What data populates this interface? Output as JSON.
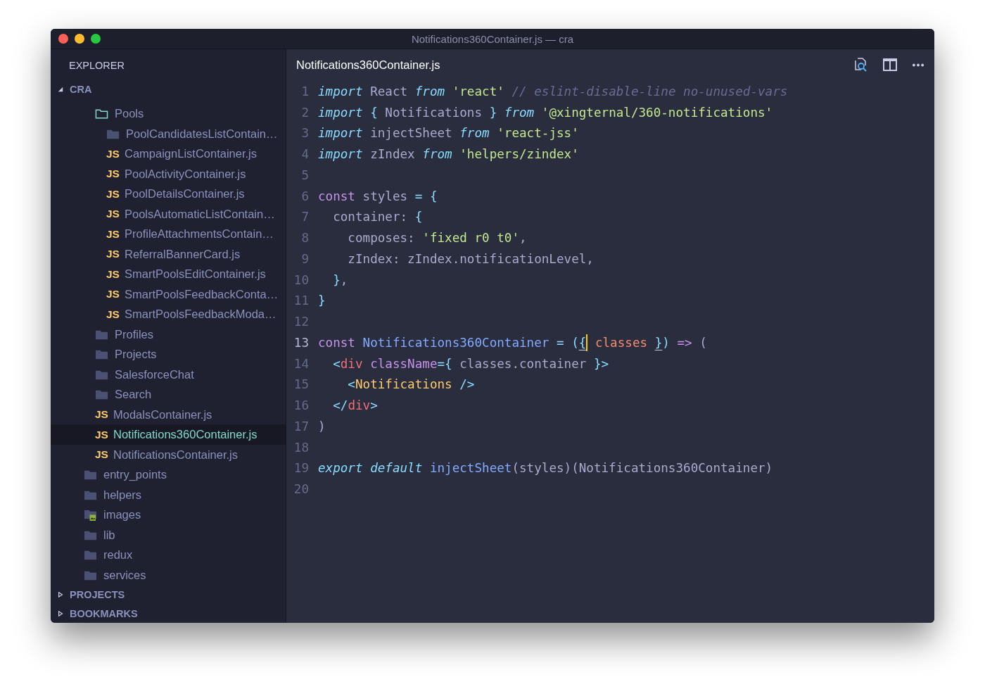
{
  "window": {
    "title": "Notifications360Container.js — cra"
  },
  "sidebar": {
    "title": "EXPLORER",
    "sections": [
      {
        "title": "CRA",
        "expanded": true,
        "tree": [
          {
            "children": [
              {
                "label": "Pools",
                "kind": "folder",
                "expanded": true,
                "selected": false,
                "children": [
                  {
                    "label": "PoolCandidatesListContain…",
                    "kind": "folder",
                    "expanded": false,
                    "selected": false
                  },
                  {
                    "label": "CampaignListContainer.js",
                    "kind": "js",
                    "badge": "JS",
                    "selected": false
                  },
                  {
                    "label": "PoolActivityContainer.js",
                    "kind": "js",
                    "badge": "JS",
                    "selected": false
                  },
                  {
                    "label": "PoolDetailsContainer.js",
                    "kind": "js",
                    "badge": "JS",
                    "selected": false
                  },
                  {
                    "label": "PoolsAutomaticListContain…",
                    "kind": "js",
                    "badge": "JS",
                    "selected": false
                  },
                  {
                    "label": "ProfileAttachmentsContain…",
                    "kind": "js",
                    "badge": "JS",
                    "selected": false
                  },
                  {
                    "label": "ReferralBannerCard.js",
                    "kind": "js",
                    "badge": "JS",
                    "selected": false
                  },
                  {
                    "label": "SmartPoolsEditContainer.js",
                    "kind": "js",
                    "badge": "JS",
                    "selected": false
                  },
                  {
                    "label": "SmartPoolsFeedbackConta…",
                    "kind": "js",
                    "badge": "JS",
                    "selected": false
                  },
                  {
                    "label": "SmartPoolsFeedbackModa…",
                    "kind": "js",
                    "badge": "JS",
                    "selected": false
                  }
                ]
              },
              {
                "label": "Profiles",
                "kind": "folder",
                "expanded": false,
                "selected": false
              },
              {
                "label": "Projects",
                "kind": "folder",
                "expanded": false,
                "selected": false
              },
              {
                "label": "SalesforceChat",
                "kind": "folder",
                "expanded": false,
                "selected": false
              },
              {
                "label": "Search",
                "kind": "folder",
                "expanded": false,
                "selected": false
              },
              {
                "label": "ModalsContainer.js",
                "kind": "js",
                "badge": "JS",
                "selected": false
              },
              {
                "label": "Notifications360Container.js",
                "kind": "js",
                "badge": "JS",
                "selected": true
              },
              {
                "label": "NotificationsContainer.js",
                "kind": "js",
                "badge": "JS",
                "selected": false
              }
            ]
          },
          {
            "label": "entry_points",
            "kind": "folder",
            "expanded": false,
            "selected": false
          },
          {
            "label": "helpers",
            "kind": "folder",
            "expanded": false,
            "selected": false
          },
          {
            "label": "images",
            "kind": "image-folder",
            "selected": false
          },
          {
            "label": "lib",
            "kind": "folder",
            "expanded": false,
            "selected": false
          },
          {
            "label": "redux",
            "kind": "folder",
            "expanded": false,
            "selected": false
          },
          {
            "label": "services",
            "kind": "folder",
            "expanded": false,
            "selected": false
          }
        ]
      },
      {
        "title": "PROJECTS",
        "expanded": false
      },
      {
        "title": "BOOKMARKS",
        "expanded": false
      }
    ]
  },
  "editor": {
    "tab_title": "Notifications360Container.js",
    "lines": [
      {
        "number": "1",
        "current": false,
        "tokens": [
          {
            "kind": "keyword",
            "text": "import"
          },
          {
            "kind": "plain",
            "text": " React "
          },
          {
            "kind": "keyword",
            "text": "from"
          },
          {
            "kind": "string",
            "text": " 'react'"
          },
          {
            "kind": "comment",
            "text": " // eslint-disable-line no-unused-vars"
          }
        ]
      },
      {
        "number": "2",
        "current": false,
        "tokens": [
          {
            "kind": "keyword",
            "text": "import"
          },
          {
            "kind": "punct",
            "text": " {"
          },
          {
            "kind": "plain",
            "text": " Notifications "
          },
          {
            "kind": "punct",
            "text": "} "
          },
          {
            "kind": "keyword",
            "text": "from"
          },
          {
            "kind": "string",
            "text": " '@xingternal/360-notifications'"
          }
        ]
      },
      {
        "number": "3",
        "current": false,
        "tokens": [
          {
            "kind": "keyword",
            "text": "import"
          },
          {
            "kind": "plain",
            "text": " injectSheet "
          },
          {
            "kind": "keyword",
            "text": "from"
          },
          {
            "kind": "string",
            "text": " 'react-jss'"
          }
        ]
      },
      {
        "number": "4",
        "current": false,
        "tokens": [
          {
            "kind": "keyword",
            "text": "import"
          },
          {
            "kind": "plain",
            "text": " zIndex "
          },
          {
            "kind": "keyword",
            "text": "from"
          },
          {
            "kind": "string",
            "text": " 'helpers/zindex'"
          }
        ]
      },
      {
        "number": "5",
        "current": false
      },
      {
        "number": "6",
        "current": false,
        "tokens": [
          {
            "kind": "storage",
            "text": "const"
          },
          {
            "kind": "plain",
            "text": " styles "
          },
          {
            "kind": "punct",
            "text": "= {"
          }
        ]
      },
      {
        "number": "7",
        "current": false,
        "tokens": [
          {
            "kind": "plain",
            "text": "  container: "
          },
          {
            "kind": "punct",
            "text": "{"
          }
        ]
      },
      {
        "number": "8",
        "current": false,
        "tokens": [
          {
            "kind": "plain",
            "text": "    composes: "
          },
          {
            "kind": "string",
            "text": "'fixed r0 t0'"
          },
          {
            "kind": "plain",
            "text": ","
          }
        ]
      },
      {
        "number": "9",
        "current": false,
        "tokens": [
          {
            "kind": "plain",
            "text": "    zIndex: zIndex.notificationLevel,"
          }
        ]
      },
      {
        "number": "10",
        "current": false,
        "tokens": [
          {
            "kind": "punct",
            "text": "  }"
          },
          {
            "kind": "plain",
            "text": ","
          }
        ]
      },
      {
        "number": "11",
        "current": false,
        "tokens": [
          {
            "kind": "punct",
            "text": "}"
          }
        ]
      },
      {
        "number": "12",
        "current": false
      },
      {
        "number": "13",
        "current": true,
        "tokens": [
          {
            "kind": "storage",
            "text": "const"
          },
          {
            "kind": "function",
            "text": " Notifications360Container"
          },
          {
            "kind": "punct",
            "text": " = ("
          },
          {
            "kind": "punct",
            "text": "{",
            "match": true,
            "cursor": true
          },
          {
            "kind": "param",
            "text": " classes "
          },
          {
            "kind": "punct",
            "text": "}",
            "match": true
          },
          {
            "kind": "punct",
            "text": ")"
          },
          {
            "kind": "storage",
            "text": " =>"
          },
          {
            "kind": "plain",
            "text": " ("
          }
        ]
      },
      {
        "number": "14",
        "current": false,
        "tokens": [
          {
            "kind": "punct",
            "text": "  <"
          },
          {
            "kind": "tag",
            "text": "div"
          },
          {
            "kind": "storage",
            "text": " className"
          },
          {
            "kind": "punct",
            "text": "={"
          },
          {
            "kind": "plain",
            "text": " classes.container "
          },
          {
            "kind": "punct",
            "text": "}>"
          }
        ]
      },
      {
        "number": "15",
        "current": false,
        "tokens": [
          {
            "kind": "punct",
            "text": "    <"
          },
          {
            "kind": "component",
            "text": "Notifications"
          },
          {
            "kind": "punct",
            "text": " />"
          }
        ]
      },
      {
        "number": "16",
        "current": false,
        "tokens": [
          {
            "kind": "punct",
            "text": "  </"
          },
          {
            "kind": "tag",
            "text": "div"
          },
          {
            "kind": "punct",
            "text": ">"
          }
        ]
      },
      {
        "number": "17",
        "current": false,
        "tokens": [
          {
            "kind": "plain",
            "text": ")"
          }
        ]
      },
      {
        "number": "18",
        "current": false
      },
      {
        "number": "19",
        "current": false,
        "tokens": [
          {
            "kind": "keyword",
            "text": "export"
          },
          {
            "kind": "keyword",
            "text": " default"
          },
          {
            "kind": "function",
            "text": " injectSheet"
          },
          {
            "kind": "plain",
            "text": "(styles)(Notifications360Container)"
          }
        ]
      },
      {
        "number": "20",
        "current": false
      }
    ]
  }
}
